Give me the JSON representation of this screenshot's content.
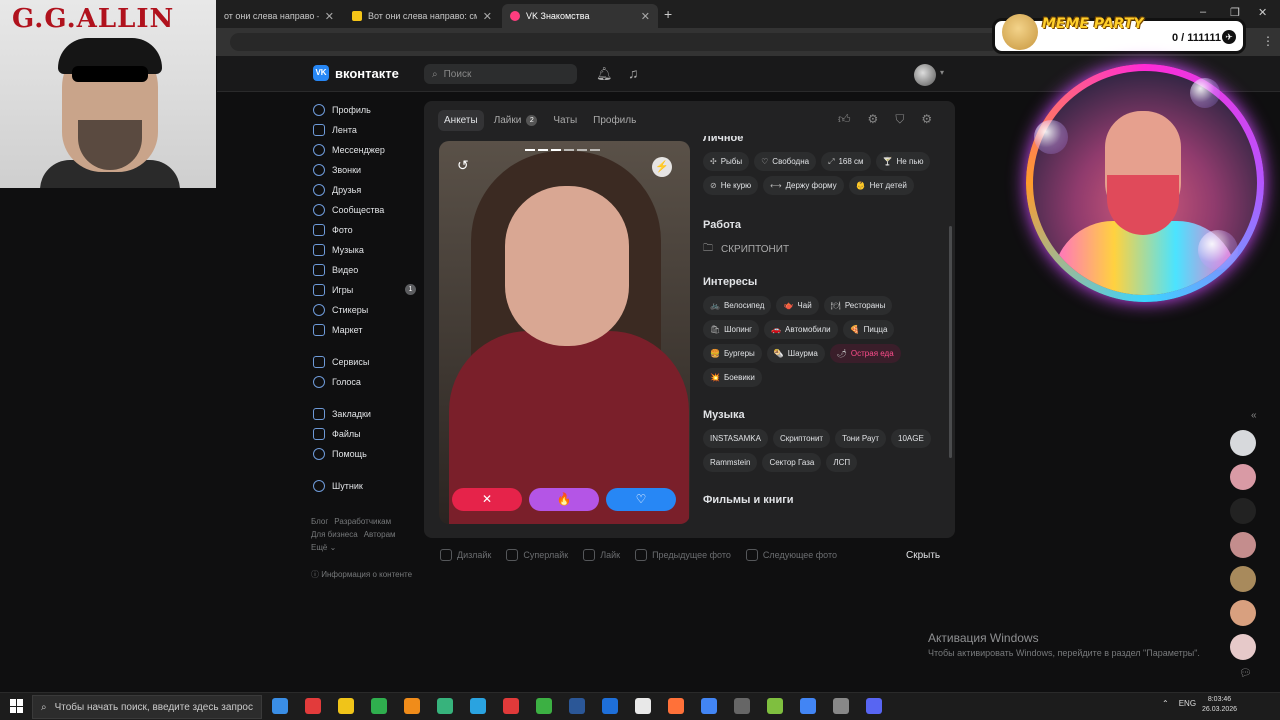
{
  "browser": {
    "tabs": [
      {
        "title": "от они слева направо — Янд",
        "active": false
      },
      {
        "title": "Вот они слева направо: смотр",
        "active": false
      },
      {
        "title": "VK Знакомства",
        "active": true
      }
    ],
    "new_tab": "+",
    "window_controls": [
      "–",
      "❐",
      "✕"
    ]
  },
  "overlays": {
    "top_left_title": "G.G.ALLIN",
    "meme_title": "MEME PARTY",
    "meme_score": "0 / 111111"
  },
  "vk": {
    "logo_text": "вконтакте",
    "search_placeholder": "Поиск",
    "sidebar": [
      {
        "label": "Профиль",
        "icon": "profile-icon"
      },
      {
        "label": "Лента",
        "icon": "feed-icon"
      },
      {
        "label": "Мессенджер",
        "icon": "messenger-icon"
      },
      {
        "label": "Звонки",
        "icon": "phone-icon"
      },
      {
        "label": "Друзья",
        "icon": "friends-icon"
      },
      {
        "label": "Сообщества",
        "icon": "groups-icon"
      },
      {
        "label": "Фото",
        "icon": "photo-icon"
      },
      {
        "label": "Музыка",
        "icon": "music-icon"
      },
      {
        "label": "Видео",
        "icon": "video-icon"
      },
      {
        "label": "Игры",
        "icon": "games-icon",
        "badge": "1"
      },
      {
        "label": "Стикеры",
        "icon": "stickers-icon"
      },
      {
        "label": "Маркет",
        "icon": "market-icon"
      },
      {
        "label": "Сервисы",
        "icon": "services-icon"
      },
      {
        "label": "Голоса",
        "icon": "coins-icon"
      },
      {
        "label": "Закладки",
        "icon": "bookmark-icon"
      },
      {
        "label": "Файлы",
        "icon": "files-icon"
      },
      {
        "label": "Помощь",
        "icon": "help-icon"
      },
      {
        "label": "Шутник",
        "icon": "joker-icon"
      }
    ],
    "footer_links": {
      "blog": "Блог",
      "developers": "Разработчикам",
      "business": "Для бизнеса",
      "authors": "Авторам",
      "more": "Ещё ⌄"
    },
    "content_info": "Информация о контенте",
    "dating": {
      "tabs": [
        {
          "label": "Анкеты",
          "active": true
        },
        {
          "label": "Лайки",
          "count": "2"
        },
        {
          "label": "Чаты"
        },
        {
          "label": "Профиль"
        }
      ],
      "personal_title": "Личное",
      "personal": [
        {
          "icon": "✣",
          "label": "Рыбы"
        },
        {
          "icon": "♡",
          "label": "Свободна"
        },
        {
          "icon": "⤢",
          "label": "168 см"
        },
        {
          "icon": "🍸",
          "label": "Не пью"
        },
        {
          "icon": "⊘",
          "label": "Не курю"
        },
        {
          "icon": "⟷",
          "label": "Держу форму"
        },
        {
          "icon": "👶",
          "label": "Нет детей"
        }
      ],
      "work_title": "Работа",
      "work_value": "СКРИПТОНИТ",
      "interests_title": "Интересы",
      "interests": [
        {
          "icon": "🚲",
          "label": "Велосипед"
        },
        {
          "icon": "🫖",
          "label": "Чай"
        },
        {
          "icon": "🍽",
          "label": "Рестораны"
        },
        {
          "icon": "🛍",
          "label": "Шопинг"
        },
        {
          "icon": "🚗",
          "label": "Автомобили"
        },
        {
          "icon": "🍕",
          "label": "Пицца"
        },
        {
          "icon": "🍔",
          "label": "Бургеры"
        },
        {
          "icon": "🌯",
          "label": "Шаурма"
        },
        {
          "icon": "🌶",
          "label": "Острая еда",
          "hot": true
        },
        {
          "icon": "💥",
          "label": "Боевики"
        }
      ],
      "music_title": "Музыка",
      "music": [
        "INSTASAMKA",
        "Скриптонит",
        "Тони Раут",
        "10AGE",
        "Rammstein",
        "Сектор Газа",
        "ЛСП"
      ],
      "films_title": "Фильмы и книги",
      "hotkeys": [
        {
          "label": "Дизлайк"
        },
        {
          "label": "Суперлайк"
        },
        {
          "label": "Лайк"
        },
        {
          "label": "Предыдущее фото"
        },
        {
          "label": "Следующее фото"
        }
      ],
      "hide": "Скрыть",
      "buttons": {
        "dislike": "✕",
        "superlike": "🔥",
        "like": "♡"
      }
    }
  },
  "windows": {
    "activate_title": "Активация Windows",
    "activate_text": "Чтобы активировать Windows, перейдите в раздел \"Параметры\".",
    "search_placeholder": "Чтобы начать поиск, введите здесь запрос",
    "lang": "ENG",
    "time": "8:03:46",
    "date": "26.03.2026"
  },
  "colors": {
    "vk_blue": "#2787f5",
    "dislike": "#e6234a",
    "superlike": "#b455e6",
    "like": "#2787f5"
  }
}
